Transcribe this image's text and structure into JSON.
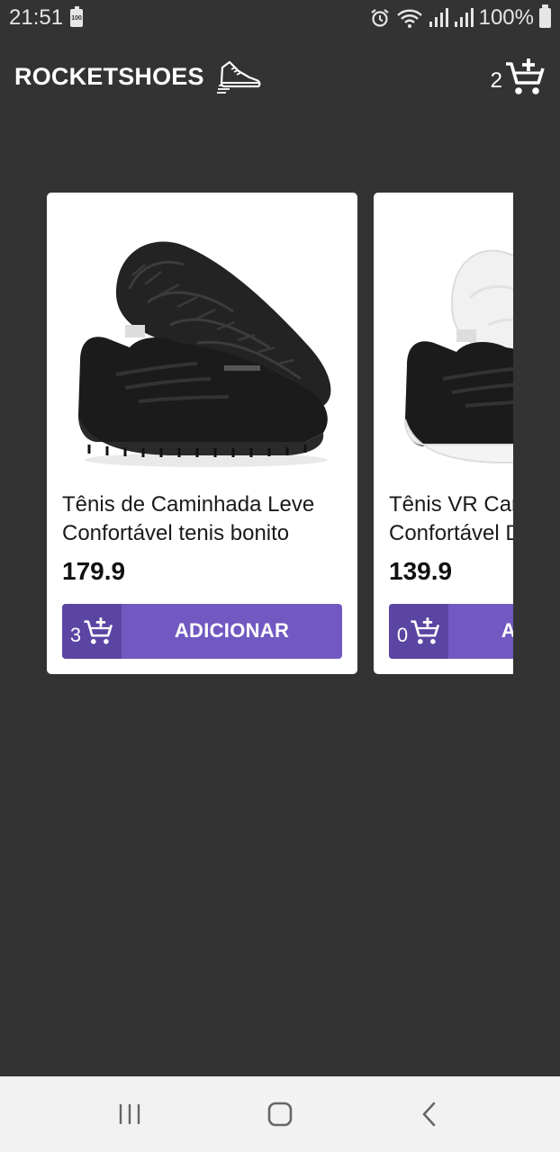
{
  "status_bar": {
    "time": "21:51",
    "battery_mini_label": "100",
    "battery_percent": "100%",
    "icons": [
      "alarm-icon",
      "wifi-icon",
      "signal-icon",
      "signal-icon",
      "battery-icon"
    ]
  },
  "header": {
    "brand": "ROCKETSHOES",
    "brand_icon": "sneaker-icon",
    "cart_count": "2",
    "cart_icon": "cart-plus-icon"
  },
  "products": [
    {
      "title": "Tênis de Caminhada Leve Confortável tenis bonito",
      "price": "179.9",
      "cart_amount": "3",
      "button_label": "ADICIONAR",
      "image": "black-sneaker-black-sole"
    },
    {
      "title": "Tênis VR Caminhada Confortável Detalhes",
      "price": "139.9",
      "cart_amount": "0",
      "button_label": "ADICIONAR",
      "image": "black-sneaker-white-sole"
    }
  ],
  "colors": {
    "background": "#333333",
    "accent": "#7159c1",
    "accent_dark": "#5a45a3",
    "card": "#ffffff"
  },
  "nav": {
    "recent_icon": "recent-apps-icon",
    "home_icon": "home-icon",
    "back_icon": "back-icon"
  }
}
